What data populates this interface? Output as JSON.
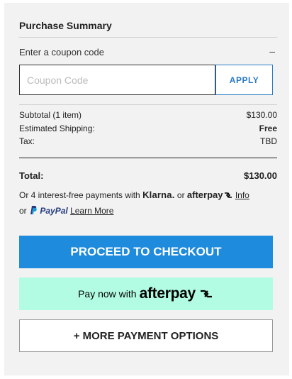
{
  "summary": {
    "title": "Purchase Summary",
    "coupon_toggle_label": "Enter a coupon code",
    "coupon_toggle_icon": "–",
    "coupon_placeholder": "Coupon Code",
    "coupon_value": "",
    "apply_label": "APPLY"
  },
  "lines": {
    "subtotal_label": "Subtotal (1 item)",
    "subtotal_value": "$130.00",
    "shipping_label": "Estimated Shipping:",
    "shipping_value": "Free",
    "tax_label": "Tax:",
    "tax_value": "TBD",
    "total_label": "Total:",
    "total_value": "$130.00"
  },
  "bnpl": {
    "prefix": "Or 4 interest-free payments with",
    "klarna": "Klarna.",
    "or1": "or",
    "afterpay": "afterpay",
    "info_link": "Info",
    "or2": "or",
    "paypal": "PayPal",
    "learn_more": "Learn More"
  },
  "buttons": {
    "checkout": "PROCEED TO CHECKOUT",
    "afterpay_prefix": "Pay now with",
    "afterpay_brand": "afterpay",
    "more_options": "+ MORE PAYMENT OPTIONS"
  },
  "colors": {
    "checkout_bg": "#1e8bdc",
    "afterpay_bg": "#b2fce4",
    "apply_accent": "#2b7bc3",
    "panel_bg": "#f2f2f2"
  }
}
